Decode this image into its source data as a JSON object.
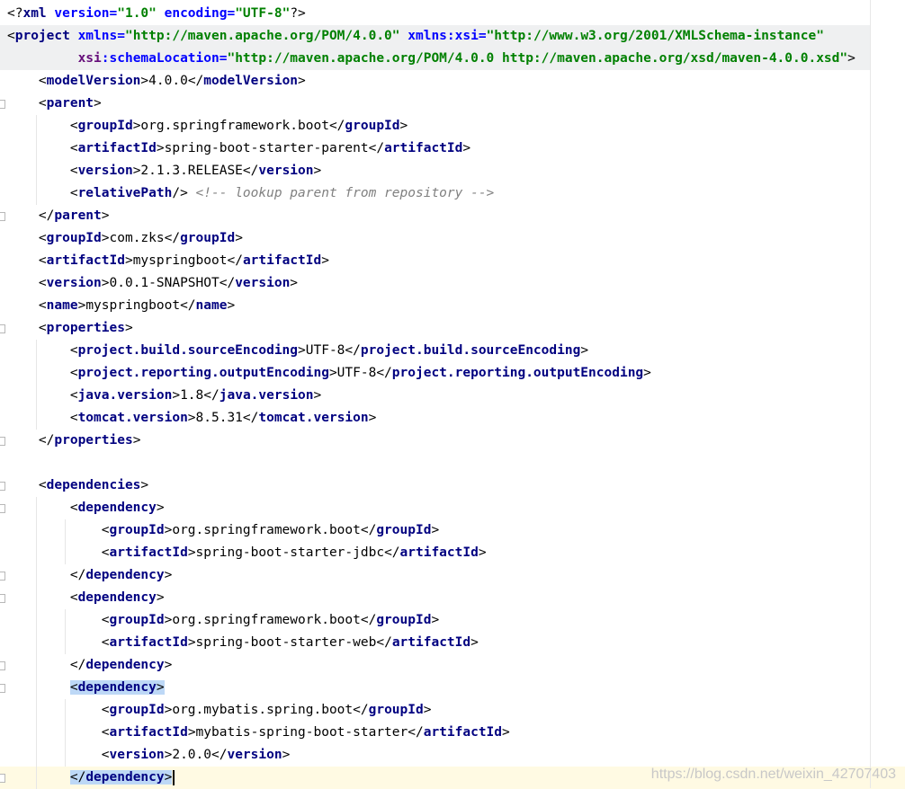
{
  "editor": {
    "language": "xml",
    "lines": [
      [
        {
          "t": "<?",
          "c": "bk"
        },
        {
          "t": "xml ",
          "c": "tg"
        },
        {
          "t": "version=",
          "c": "at"
        },
        {
          "t": "\"1.0\"",
          "c": "sv"
        },
        {
          "t": " encoding=",
          "c": "at"
        },
        {
          "t": "\"UTF-8\"",
          "c": "sv"
        },
        {
          "t": "?>",
          "c": "bk"
        }
      ],
      [
        {
          "t": "<",
          "c": "bk"
        },
        {
          "t": "project ",
          "c": "tg"
        },
        {
          "t": "xmlns=",
          "c": "at"
        },
        {
          "t": "\"http://maven.apache.org/POM/4.0.0\"",
          "c": "sv"
        },
        {
          "t": " ",
          "c": "bk"
        },
        {
          "t": "xmlns:xsi",
          "c": "at"
        },
        {
          "t": "=",
          "c": "at"
        },
        {
          "t": "\"http://www.w3.org/2001/XMLSchema-instance\"",
          "c": "sv"
        }
      ],
      [
        {
          "t": "         ",
          "c": "bk"
        },
        {
          "t": "xsi",
          "c": "ns"
        },
        {
          "t": ":schemaLocation=",
          "c": "at"
        },
        {
          "t": "\"http://maven.apache.org/POM/4.0.0 http://maven.apache.org/xsd/maven-4.0.0.xsd\"",
          "c": "sv"
        },
        {
          "t": ">",
          "c": "bk"
        }
      ],
      [
        {
          "t": "    <",
          "c": "bk"
        },
        {
          "t": "modelVersion",
          "c": "tg"
        },
        {
          "t": ">",
          "c": "bk"
        },
        {
          "t": "4.0.0",
          "c": "txt"
        },
        {
          "t": "</",
          "c": "bk"
        },
        {
          "t": "modelVersion",
          "c": "tg"
        },
        {
          "t": ">",
          "c": "bk"
        }
      ],
      [
        {
          "t": "    <",
          "c": "bk"
        },
        {
          "t": "parent",
          "c": "tg"
        },
        {
          "t": ">",
          "c": "bk"
        }
      ],
      [
        {
          "t": "        <",
          "c": "bk"
        },
        {
          "t": "groupId",
          "c": "tg"
        },
        {
          "t": ">",
          "c": "bk"
        },
        {
          "t": "org.springframework.boot",
          "c": "txt"
        },
        {
          "t": "</",
          "c": "bk"
        },
        {
          "t": "groupId",
          "c": "tg"
        },
        {
          "t": ">",
          "c": "bk"
        }
      ],
      [
        {
          "t": "        <",
          "c": "bk"
        },
        {
          "t": "artifactId",
          "c": "tg"
        },
        {
          "t": ">",
          "c": "bk"
        },
        {
          "t": "spring-boot-starter-parent",
          "c": "txt"
        },
        {
          "t": "</",
          "c": "bk"
        },
        {
          "t": "artifactId",
          "c": "tg"
        },
        {
          "t": ">",
          "c": "bk"
        }
      ],
      [
        {
          "t": "        <",
          "c": "bk"
        },
        {
          "t": "version",
          "c": "tg"
        },
        {
          "t": ">",
          "c": "bk"
        },
        {
          "t": "2.1.3.RELEASE",
          "c": "txt"
        },
        {
          "t": "</",
          "c": "bk"
        },
        {
          "t": "version",
          "c": "tg"
        },
        {
          "t": ">",
          "c": "bk"
        }
      ],
      [
        {
          "t": "        <",
          "c": "bk"
        },
        {
          "t": "relativePath",
          "c": "tg"
        },
        {
          "t": "/>",
          "c": "bk"
        },
        {
          "t": " ",
          "c": "bk"
        },
        {
          "t": "<!-- lookup parent from repository -->",
          "c": "cm"
        }
      ],
      [
        {
          "t": "    </",
          "c": "bk"
        },
        {
          "t": "parent",
          "c": "tg"
        },
        {
          "t": ">",
          "c": "bk"
        }
      ],
      [
        {
          "t": "    <",
          "c": "bk"
        },
        {
          "t": "groupId",
          "c": "tg"
        },
        {
          "t": ">",
          "c": "bk"
        },
        {
          "t": "com.zks",
          "c": "txt"
        },
        {
          "t": "</",
          "c": "bk"
        },
        {
          "t": "groupId",
          "c": "tg"
        },
        {
          "t": ">",
          "c": "bk"
        }
      ],
      [
        {
          "t": "    <",
          "c": "bk"
        },
        {
          "t": "artifactId",
          "c": "tg"
        },
        {
          "t": ">",
          "c": "bk"
        },
        {
          "t": "myspringboot",
          "c": "txt"
        },
        {
          "t": "</",
          "c": "bk"
        },
        {
          "t": "artifactId",
          "c": "tg"
        },
        {
          "t": ">",
          "c": "bk"
        }
      ],
      [
        {
          "t": "    <",
          "c": "bk"
        },
        {
          "t": "version",
          "c": "tg"
        },
        {
          "t": ">",
          "c": "bk"
        },
        {
          "t": "0.0.1-SNAPSHOT",
          "c": "txt"
        },
        {
          "t": "</",
          "c": "bk"
        },
        {
          "t": "version",
          "c": "tg"
        },
        {
          "t": ">",
          "c": "bk"
        }
      ],
      [
        {
          "t": "    <",
          "c": "bk"
        },
        {
          "t": "name",
          "c": "tg"
        },
        {
          "t": ">",
          "c": "bk"
        },
        {
          "t": "myspringboot",
          "c": "txt"
        },
        {
          "t": "</",
          "c": "bk"
        },
        {
          "t": "name",
          "c": "tg"
        },
        {
          "t": ">",
          "c": "bk"
        }
      ],
      [
        {
          "t": "    <",
          "c": "bk"
        },
        {
          "t": "properties",
          "c": "tg"
        },
        {
          "t": ">",
          "c": "bk"
        }
      ],
      [
        {
          "t": "        <",
          "c": "bk"
        },
        {
          "t": "project.build.sourceEncoding",
          "c": "tg"
        },
        {
          "t": ">",
          "c": "bk"
        },
        {
          "t": "UTF-8",
          "c": "txt"
        },
        {
          "t": "</",
          "c": "bk"
        },
        {
          "t": "project.build.sourceEncoding",
          "c": "tg"
        },
        {
          "t": ">",
          "c": "bk"
        }
      ],
      [
        {
          "t": "        <",
          "c": "bk"
        },
        {
          "t": "project.reporting.outputEncoding",
          "c": "tg"
        },
        {
          "t": ">",
          "c": "bk"
        },
        {
          "t": "UTF-8",
          "c": "txt"
        },
        {
          "t": "</",
          "c": "bk"
        },
        {
          "t": "project.reporting.outputEncoding",
          "c": "tg"
        },
        {
          "t": ">",
          "c": "bk"
        }
      ],
      [
        {
          "t": "        <",
          "c": "bk"
        },
        {
          "t": "java.version",
          "c": "tg"
        },
        {
          "t": ">",
          "c": "bk"
        },
        {
          "t": "1.8",
          "c": "txt"
        },
        {
          "t": "</",
          "c": "bk"
        },
        {
          "t": "java.version",
          "c": "tg"
        },
        {
          "t": ">",
          "c": "bk"
        }
      ],
      [
        {
          "t": "        <",
          "c": "bk"
        },
        {
          "t": "tomcat.version",
          "c": "tg"
        },
        {
          "t": ">",
          "c": "bk"
        },
        {
          "t": "8.5.31",
          "c": "txt"
        },
        {
          "t": "</",
          "c": "bk"
        },
        {
          "t": "tomcat.version",
          "c": "tg"
        },
        {
          "t": ">",
          "c": "bk"
        }
      ],
      [
        {
          "t": "    </",
          "c": "bk"
        },
        {
          "t": "properties",
          "c": "tg"
        },
        {
          "t": ">",
          "c": "bk"
        }
      ],
      [],
      [
        {
          "t": "    <",
          "c": "bk"
        },
        {
          "t": "dependencies",
          "c": "tg"
        },
        {
          "t": ">",
          "c": "bk"
        }
      ],
      [
        {
          "t": "        <",
          "c": "bk"
        },
        {
          "t": "dependency",
          "c": "tg"
        },
        {
          "t": ">",
          "c": "bk"
        }
      ],
      [
        {
          "t": "            <",
          "c": "bk"
        },
        {
          "t": "groupId",
          "c": "tg"
        },
        {
          "t": ">",
          "c": "bk"
        },
        {
          "t": "org.springframework.boot",
          "c": "txt"
        },
        {
          "t": "</",
          "c": "bk"
        },
        {
          "t": "groupId",
          "c": "tg"
        },
        {
          "t": ">",
          "c": "bk"
        }
      ],
      [
        {
          "t": "            <",
          "c": "bk"
        },
        {
          "t": "artifactId",
          "c": "tg"
        },
        {
          "t": ">",
          "c": "bk"
        },
        {
          "t": "spring-boot-starter-jdbc",
          "c": "txt"
        },
        {
          "t": "</",
          "c": "bk"
        },
        {
          "t": "artifactId",
          "c": "tg"
        },
        {
          "t": ">",
          "c": "bk"
        }
      ],
      [
        {
          "t": "        </",
          "c": "bk"
        },
        {
          "t": "dependency",
          "c": "tg"
        },
        {
          "t": ">",
          "c": "bk"
        }
      ],
      [
        {
          "t": "        <",
          "c": "bk"
        },
        {
          "t": "dependency",
          "c": "tg"
        },
        {
          "t": ">",
          "c": "bk"
        }
      ],
      [
        {
          "t": "            <",
          "c": "bk"
        },
        {
          "t": "groupId",
          "c": "tg"
        },
        {
          "t": ">",
          "c": "bk"
        },
        {
          "t": "org.springframework.boot",
          "c": "txt"
        },
        {
          "t": "</",
          "c": "bk"
        },
        {
          "t": "groupId",
          "c": "tg"
        },
        {
          "t": ">",
          "c": "bk"
        }
      ],
      [
        {
          "t": "            <",
          "c": "bk"
        },
        {
          "t": "artifactId",
          "c": "tg"
        },
        {
          "t": ">",
          "c": "bk"
        },
        {
          "t": "spring-boot-starter-web",
          "c": "txt"
        },
        {
          "t": "</",
          "c": "bk"
        },
        {
          "t": "artifactId",
          "c": "tg"
        },
        {
          "t": ">",
          "c": "bk"
        }
      ],
      [
        {
          "t": "        </",
          "c": "bk"
        },
        {
          "t": "dependency",
          "c": "tg"
        },
        {
          "t": ">",
          "c": "bk"
        }
      ],
      [
        {
          "t": "        ",
          "c": "bk"
        },
        {
          "t": "<",
          "c": "bk",
          "hl": true
        },
        {
          "t": "dependency",
          "c": "tg",
          "hl": true
        },
        {
          "t": ">",
          "c": "bk",
          "hl": true
        }
      ],
      [
        {
          "t": "            <",
          "c": "bk"
        },
        {
          "t": "groupId",
          "c": "tg"
        },
        {
          "t": ">",
          "c": "bk"
        },
        {
          "t": "org.mybatis.spring.boot",
          "c": "txt"
        },
        {
          "t": "</",
          "c": "bk"
        },
        {
          "t": "groupId",
          "c": "tg"
        },
        {
          "t": ">",
          "c": "bk"
        }
      ],
      [
        {
          "t": "            <",
          "c": "bk"
        },
        {
          "t": "artifactId",
          "c": "tg"
        },
        {
          "t": ">",
          "c": "bk"
        },
        {
          "t": "mybatis-spring-boot-starter",
          "c": "txt"
        },
        {
          "t": "</",
          "c": "bk"
        },
        {
          "t": "artifactId",
          "c": "tg"
        },
        {
          "t": ">",
          "c": "bk"
        }
      ],
      [
        {
          "t": "            <",
          "c": "bk"
        },
        {
          "t": "version",
          "c": "tg"
        },
        {
          "t": ">",
          "c": "bk"
        },
        {
          "t": "2.0.0",
          "c": "txt"
        },
        {
          "t": "</",
          "c": "bk"
        },
        {
          "t": "version",
          "c": "tg"
        },
        {
          "t": ">",
          "c": "bk"
        }
      ],
      [
        {
          "t": "        ",
          "c": "bk"
        },
        {
          "t": "</",
          "c": "bk",
          "hl": true
        },
        {
          "t": "dependency",
          "c": "tg",
          "hl": true
        },
        {
          "t": ">",
          "c": "bk",
          "hl": true
        }
      ]
    ]
  },
  "watermark": "https://blog.csdn.net/weixin_42707403"
}
